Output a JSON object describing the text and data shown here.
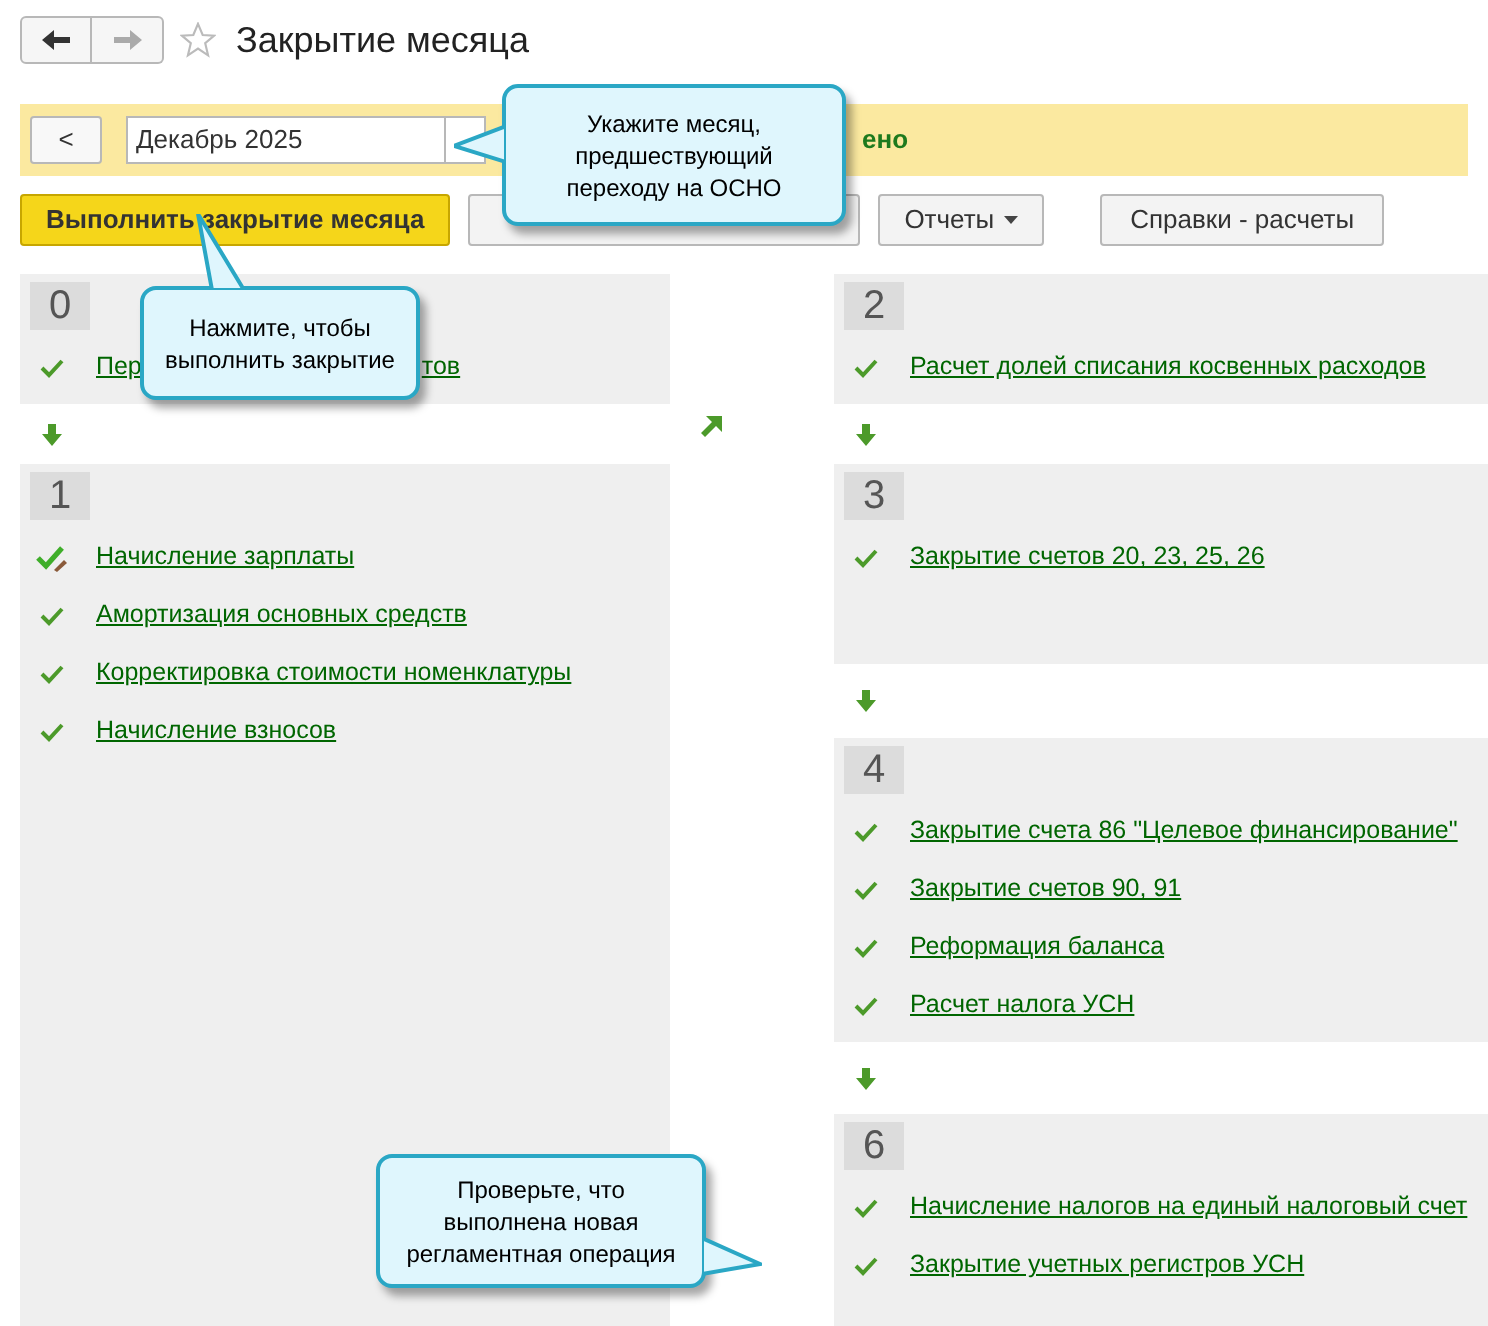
{
  "header": {
    "title": "Закрытие месяца",
    "favorite": false
  },
  "period": {
    "prev_button": "<",
    "value": "Декабрь 2025",
    "status_fragment": "ено"
  },
  "toolbar": [
    {
      "kind": "primary",
      "label": "Выполнить закрытие месяца"
    },
    {
      "kind": "hidden"
    },
    {
      "kind": "menu",
      "label": "Отчеты"
    },
    {
      "kind": "plain",
      "label": "Справки - расчеты"
    }
  ],
  "left_stages": [
    {
      "number": "0",
      "items": [
        {
          "kind": "check",
          "text": "Пер",
          "text_tail": "тов"
        }
      ]
    },
    {
      "number": "1",
      "items": [
        {
          "kind": "check_edit",
          "text": "Начисление зарплаты"
        },
        {
          "kind": "check",
          "text": "Амортизация основных средств"
        },
        {
          "kind": "check",
          "text": "Корректировка стоимости номенклатуры"
        },
        {
          "kind": "check",
          "text": "Начисление взносов"
        }
      ]
    }
  ],
  "right_stages": [
    {
      "number": "2",
      "items": [
        {
          "kind": "check",
          "text": "Расчет долей списания косвенных расходов"
        }
      ]
    },
    {
      "number": "3",
      "items": [
        {
          "kind": "check",
          "text": "Закрытие счетов 20, 23, 25, 26"
        }
      ]
    },
    {
      "number": "4",
      "items": [
        {
          "kind": "check",
          "text": "Закрытие счета 86 \"Целевое финансирование\""
        },
        {
          "kind": "check",
          "text": "Закрытие счетов 90, 91"
        },
        {
          "kind": "check",
          "text": "Реформация баланса"
        },
        {
          "kind": "check",
          "text": "Расчет налога УСН"
        }
      ]
    },
    {
      "number": "6",
      "items": [
        {
          "kind": "check",
          "text": "Начисление налогов на единый налоговый счет"
        },
        {
          "kind": "check",
          "text": "Закрытие учетных регистров УСН"
        }
      ]
    }
  ],
  "callouts": [
    {
      "kind": "left",
      "text": "Укажите месяц, предшествующий переходу на ОСНО"
    },
    {
      "kind": "up",
      "text": "Нажмите, чтобы выполнить закрытие"
    },
    {
      "kind": "right",
      "text": "Проверьте, что выполнена новая регламентная операция"
    }
  ]
}
